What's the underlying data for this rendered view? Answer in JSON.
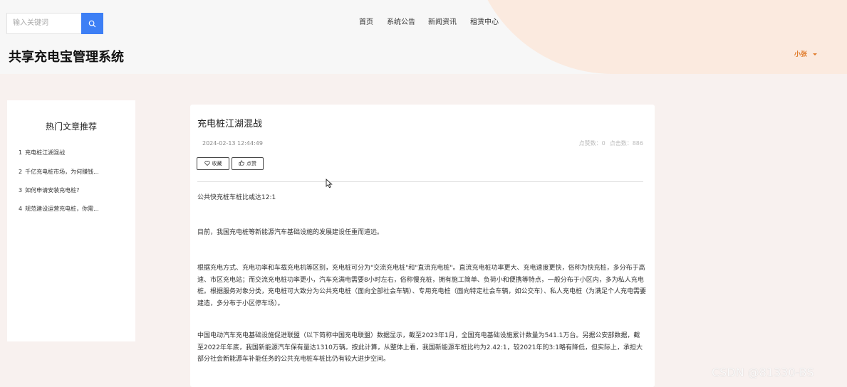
{
  "search": {
    "placeholder": "输入关键词"
  },
  "nav": [
    {
      "label": "首页"
    },
    {
      "label": "系统公告"
    },
    {
      "label": "新闻资讯"
    },
    {
      "label": "租赁中心"
    }
  ],
  "site_title": "共享充电宝管理系统",
  "user": {
    "name": "小张"
  },
  "sidebar": {
    "title": "热门文章推荐",
    "items": [
      {
        "index": "1",
        "label": "充电桩江湖混战"
      },
      {
        "index": "2",
        "label": "千亿充电桩市场，为何赚钱..."
      },
      {
        "index": "3",
        "label": "如何申请安装充电桩?"
      },
      {
        "index": "4",
        "label": "规范建设运营充电桩，你需..."
      }
    ]
  },
  "article": {
    "title": "充电桩江湖混战",
    "date": "2024-02-13 12:44:49",
    "likes_label": "点赞数：0",
    "clicks_label": "点击数：886",
    "collect_label": "收藏",
    "like_label": "点赞",
    "paragraphs": [
      "公共快充桩车桩比或达12:1",
      "目前，我国充电桩等新能源汽车基础设施的发展建设任重而道远。",
      "根据充电方式、充电功率和车载充电机等区别，充电桩可分为\"交流充电桩\"和\"直流充电桩\"。直流充电桩功率更大、充电速度更快，俗称为快充桩，多分布于高速、市区充电站；而交流充电桩功率更小，汽车充满电需要8小时左右，俗称慢充桩，拥有施工简单、负荷小和便携等特点，一般分布于小区内，多为私人充电桩。根据服务对象分类，充电桩可大致分为公共充电桩（面向全部社会车辆）、专用充电桩（面向特定社会车辆，如公交车）、私人充电桩（为满足个人充电需要建造，多分布于小区停车场）。",
      "中国电动汽车充电基础设施促进联盟（以下简称中国充电联盟）数据显示，截至2023年1月，全国充电基础设施累计数量为541.1万台。另据公安部数据，截至2022年年底，我国新能源汽车保有量达1310万辆。按此计算，从整体上看，我国新能源车桩比约为2.42:1，较2021年的3:1略有降低，但实际上，承担大部分社会新能源车补能任务的公共充电桩车桩比仍有较大进步空间。"
    ]
  },
  "watermark": "CSDN @81330-BS",
  "colors": {
    "accent": "#3d7ff5",
    "user": "#e07b2a"
  }
}
